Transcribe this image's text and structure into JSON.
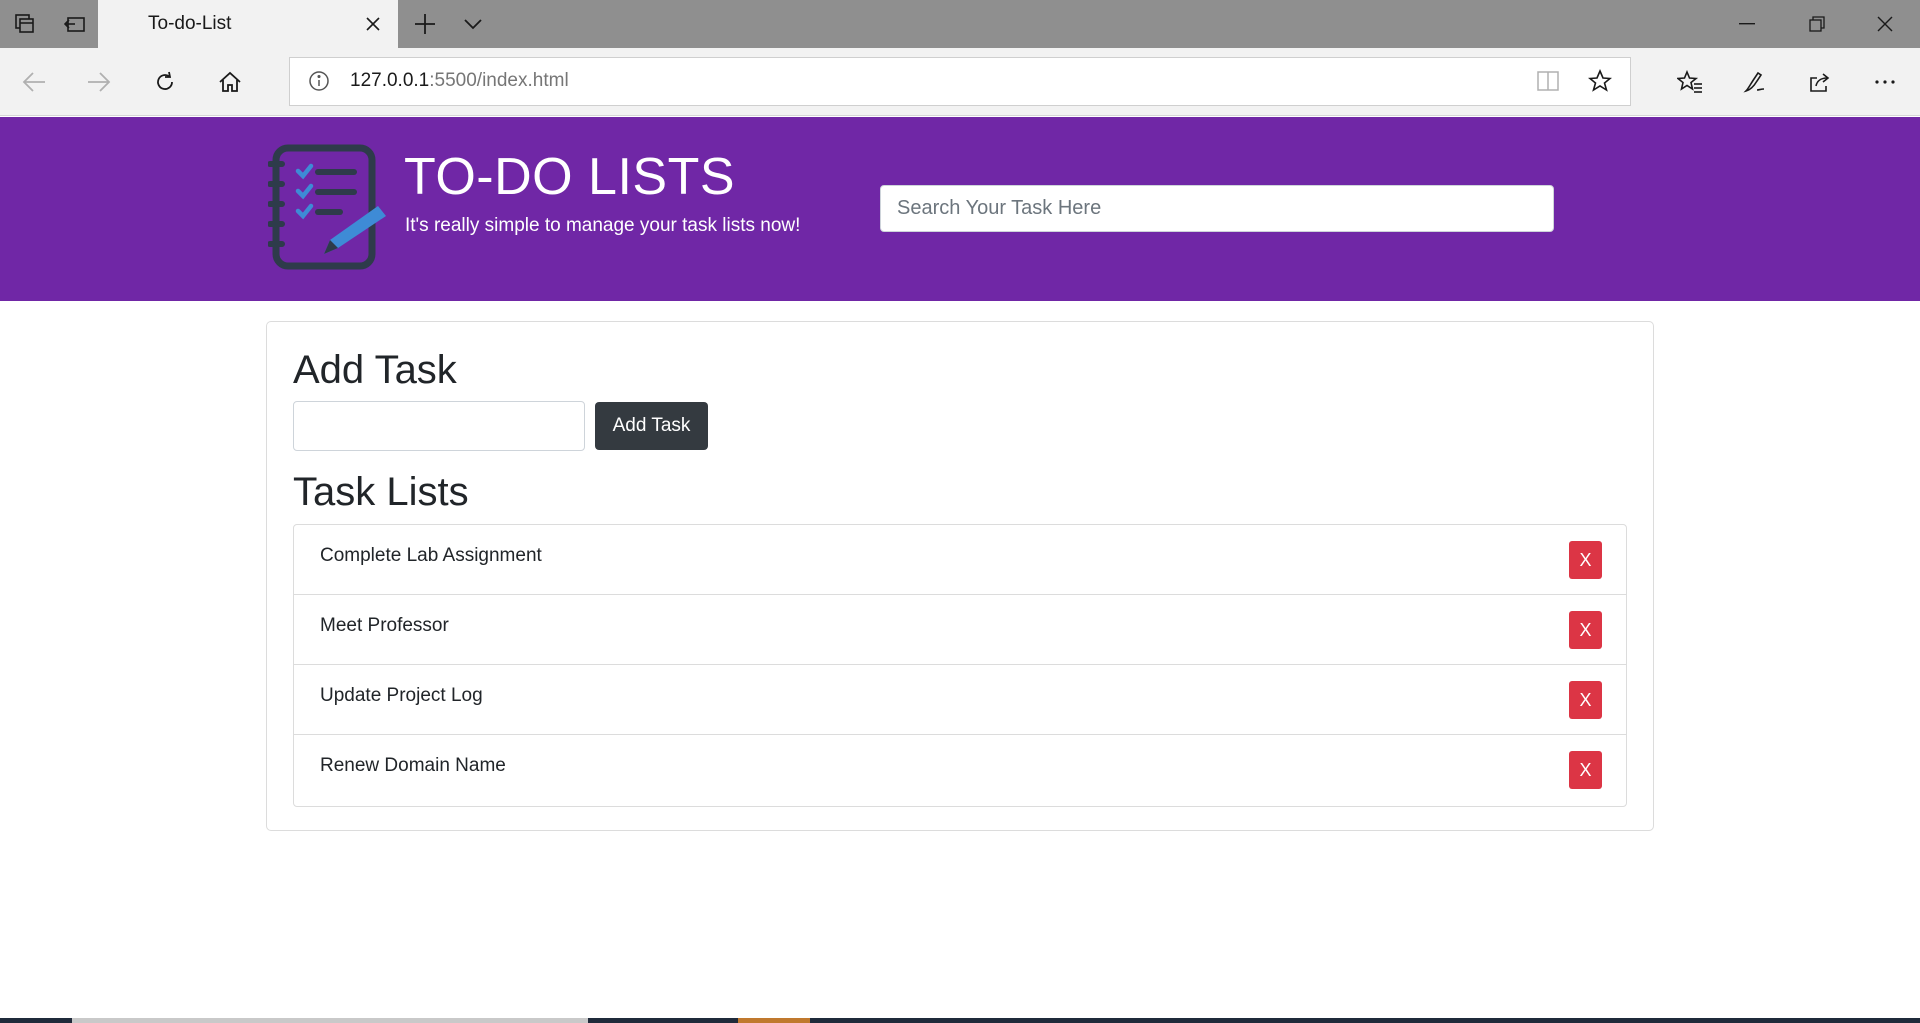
{
  "browser": {
    "tab_title": "To-do-List",
    "url_host": "127.0.0.1",
    "url_path": ":5500/index.html"
  },
  "header": {
    "title": "TO-DO LISTS",
    "subtitle": "It's really simple to manage your task lists now!",
    "search_placeholder": "Search Your Task Here"
  },
  "main": {
    "add_heading": "Add Task",
    "add_input_value": "",
    "add_button_label": "Add Task",
    "lists_heading": "Task Lists",
    "delete_label": "X",
    "tasks": [
      {
        "label": "Complete Lab Assignment"
      },
      {
        "label": "Meet Professor"
      },
      {
        "label": "Update Project Log"
      },
      {
        "label": "Renew Domain Name"
      }
    ]
  },
  "colors": {
    "header_bg": "#7027a6",
    "add_button": "#343a40",
    "delete_button": "#dc3545"
  },
  "icons": {
    "tab_actions": "tab-actions-icon",
    "set_aside": "set-aside-tabs-icon",
    "new_tab": "plus-icon",
    "tab_list": "chevron-down-icon",
    "back": "back-arrow-icon",
    "forward": "forward-arrow-icon",
    "refresh": "refresh-icon",
    "home": "home-icon",
    "logo": "checklist-notebook-icon"
  }
}
